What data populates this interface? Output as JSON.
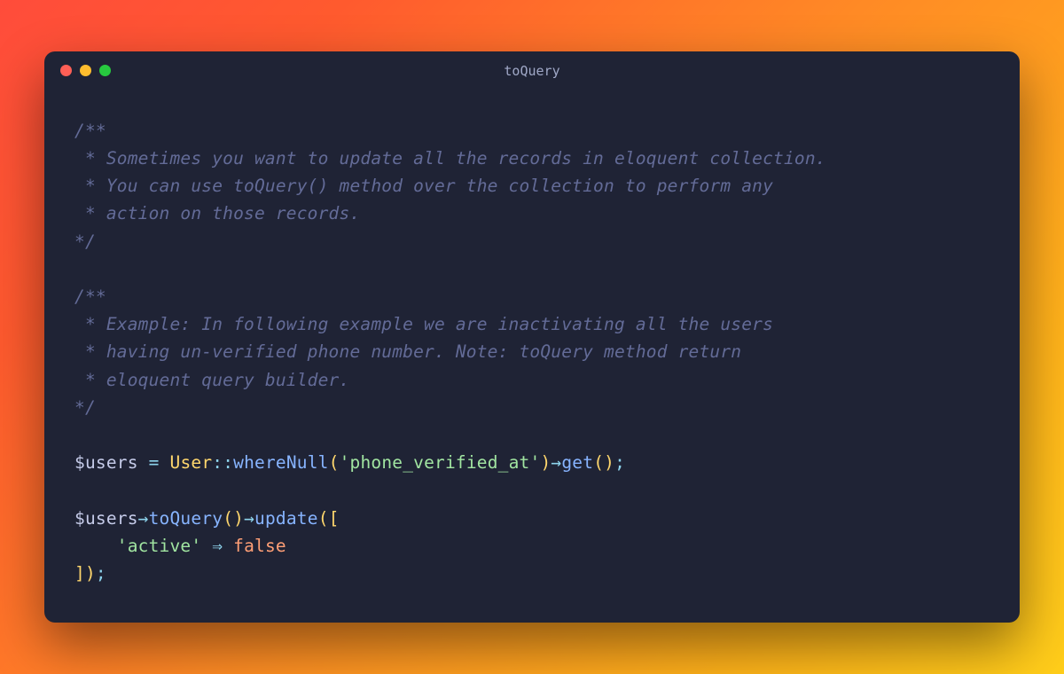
{
  "window": {
    "title": "toQuery"
  },
  "code": {
    "comment1": {
      "l1": "/**",
      "l2": " * Sometimes you want to update all the records in eloquent collection.",
      "l3": " * You can use toQuery() method over the collection to perform any",
      "l4": " * action on those records.",
      "l5": "*/"
    },
    "comment2": {
      "l1": "/**",
      "l2": " * Example: In following example we are inactivating all the users",
      "l3": " * having un-verified phone number. Note: toQuery method return",
      "l4": " * eloquent query builder.",
      "l5": "*/"
    },
    "line1": {
      "var": "$users",
      "sp1": " ",
      "eq": "=",
      "sp2": " ",
      "cls": "User",
      "dcolon": "::",
      "whereNull": "whereNull",
      "po1": "(",
      "str1": "'phone_verified_at'",
      "pc1": ")",
      "arr1": "→",
      "get": "get",
      "po2": "(",
      "pc2": ")",
      "semi": ";"
    },
    "line2": {
      "var": "$users",
      "arr1": "→",
      "toQuery": "toQuery",
      "po1": "(",
      "pc1": ")",
      "arr2": "→",
      "update": "update",
      "po2": "(",
      "br1": "["
    },
    "line3": {
      "indent": "    ",
      "str": "'active'",
      "sp1": " ",
      "fat": "⇒",
      "sp2": " ",
      "false": "false"
    },
    "line4": {
      "br2": "]",
      "pc2": ")",
      "semi": ";"
    }
  }
}
